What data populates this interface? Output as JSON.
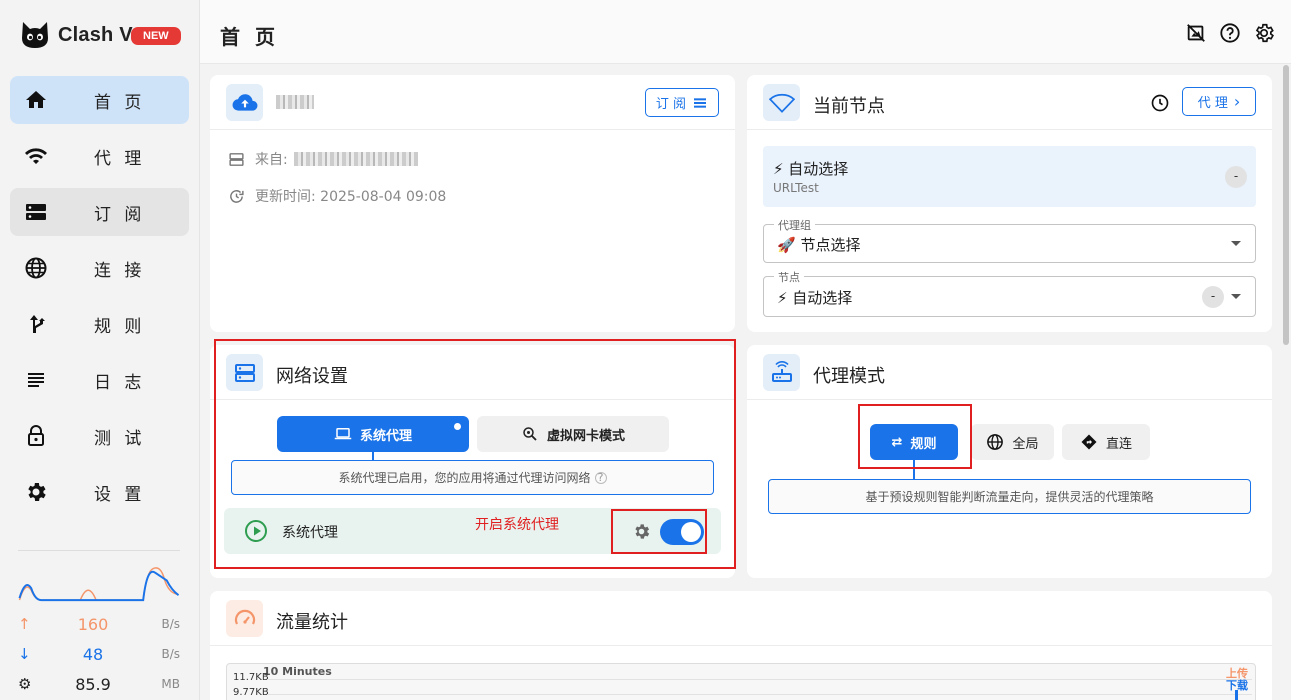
{
  "app": {
    "name": "Clash V",
    "badge": "NEW"
  },
  "sidebar": {
    "items": [
      {
        "label": "首 页",
        "icon": "home-icon"
      },
      {
        "label": "代 理",
        "icon": "wifi-icon"
      },
      {
        "label": "订 阅",
        "icon": "server-icon"
      },
      {
        "label": "连 接",
        "icon": "globe-icon"
      },
      {
        "label": "规 则",
        "icon": "fork-route-icon"
      },
      {
        "label": "日 志",
        "icon": "list-lines-icon"
      },
      {
        "label": "测 试",
        "icon": "lock-icon"
      },
      {
        "label": "设 置",
        "icon": "gear-icon"
      }
    ],
    "traffic": {
      "upload_value": "160",
      "upload_unit": "B/s",
      "download_value": "48",
      "download_unit": "B/s",
      "memory_value": "85.9",
      "memory_unit": "MB"
    }
  },
  "header": {
    "title": "首 页"
  },
  "profile_card": {
    "name_blurred": true,
    "subscribe_label": "订 阅",
    "from_label": "来自:",
    "updated_label": "更新时间: 2025-08-04 09:08"
  },
  "node_card": {
    "title": "当前节点",
    "proxy_button_label": "代 理",
    "selected_node": "⚡ 自动选择",
    "selected_type": "URLTest",
    "selected_delay": "-",
    "group_legend": "代理组",
    "group_value": "🚀 节点选择",
    "node_legend": "节点",
    "node_value": "⚡ 自动选择",
    "node_delay": "-"
  },
  "network_card": {
    "title": "网络设置",
    "system_proxy_tab": "系统代理",
    "tun_tab": "虚拟网卡模式",
    "info": "系统代理已启用，您的应用将通过代理访问网络",
    "row_label": "系统代理",
    "annotation": "开启系统代理",
    "toggle_on": true
  },
  "mode_card": {
    "title": "代理模式",
    "rule_label": "规则",
    "global_label": "全局",
    "direct_label": "直连",
    "info": "基于预设规则智能判断流量走向，提供灵活的代理策略"
  },
  "traffic_card": {
    "title": "流量统计",
    "range_label": "10 Minutes",
    "y_ticks": [
      "11.7KB",
      "9.77KB"
    ],
    "legend_upload": "上传",
    "legend_download": "下载"
  },
  "colors": {
    "accent": "#1a73e8",
    "annotation": "#e02020",
    "upload": "#f4956a",
    "download": "#1a73e8",
    "success": "#2e9d4f"
  }
}
